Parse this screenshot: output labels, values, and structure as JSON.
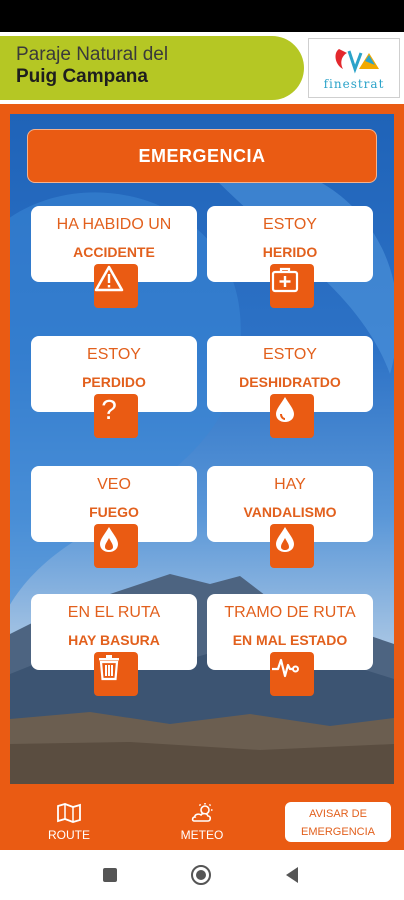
{
  "header": {
    "title_line1": "Paraje Natural del",
    "title_line2": "Puig Campana",
    "logo_text": "finestrat"
  },
  "emergency_button": "EMERGENCIA",
  "cards": [
    {
      "line1": "HA HABIDO UN",
      "line2": "ACCIDENTE",
      "icon": "warning-icon"
    },
    {
      "line1": "ESTOY",
      "line2": "HERIDO",
      "icon": "first-aid-kit-icon"
    },
    {
      "line1": "ESTOY",
      "line2": "PERDIDO",
      "icon": "question-icon"
    },
    {
      "line1": "ESTOY",
      "line2": "DESHIDRATDO",
      "icon": "water-drop-icon"
    },
    {
      "line1": "VEO",
      "line2": "FUEGO",
      "icon": "fire-icon"
    },
    {
      "line1": "HAY",
      "line2": "VANDALISMO",
      "icon": "fire-icon"
    },
    {
      "line1": "EN EL RUTA",
      "line2": "HAY BASURA",
      "icon": "trash-icon"
    },
    {
      "line1": "TRAMO DE RUTA",
      "line2": "EN MAL ESTADO",
      "icon": "pulse-icon"
    }
  ],
  "bottom_nav": {
    "route_label": "ROUTE",
    "meteo_label": "METEO",
    "alert_line1": "AVISAR DE",
    "alert_line2": "EMERGENCIA"
  },
  "colors": {
    "accent": "#ea5b13",
    "header_pill": "#b5c724",
    "card_text": "#e2601d"
  }
}
